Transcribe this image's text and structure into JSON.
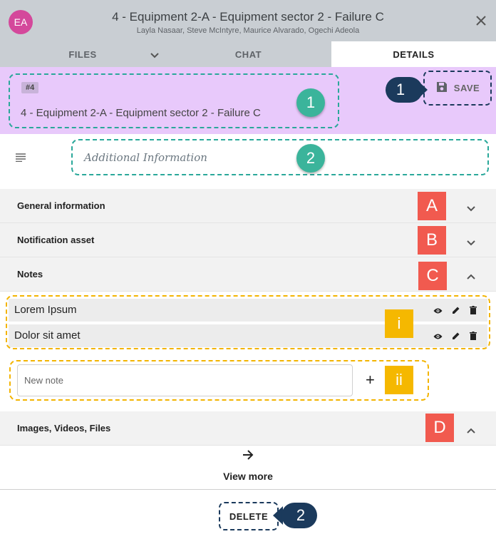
{
  "header": {
    "avatar_initials": "EA",
    "title": "4 - Equipment 2-A - Equipment sector 2 - Failure C",
    "subtitle": "Layla Nasaar, Steve McIntyre, Maurice Alvarado, Ogechi Adeola",
    "close_icon": "close-icon"
  },
  "tabs": [
    {
      "label": "FILES"
    },
    {
      "label": "CHAT"
    },
    {
      "label": "DETAILS",
      "active": true
    }
  ],
  "notification": {
    "number_badge": "#4",
    "title": "4 - Equipment 2-A - Equipment sector 2 - Failure C",
    "save_label": "SAVE",
    "additional_info_placeholder": "Additional Information"
  },
  "sections": [
    {
      "label": "General information",
      "marker": "A",
      "expanded": false
    },
    {
      "label": "Notification asset",
      "marker": "B",
      "expanded": false
    },
    {
      "label": "Notes",
      "marker": "C",
      "expanded": true
    },
    {
      "label": "Images, Videos, Files",
      "marker": "D",
      "expanded": true
    }
  ],
  "notes": [
    {
      "text": "Lorem Ipsum"
    },
    {
      "text": "Dolor sit amet"
    }
  ],
  "new_note_placeholder": "New note",
  "add_symbol": "+",
  "view_more_label": "View more",
  "delete_label": "DELETE",
  "markers": {
    "green_1": "1",
    "green_2": "2",
    "pin_save": "1",
    "pin_delete": "2",
    "notes_list": "i",
    "new_note": "ii"
  },
  "colors": {
    "header_bg": "#c9ced3",
    "purple_bg": "#e8c9fb",
    "avatar": "#d4489b",
    "green_marker": "#3bb49b",
    "red_marker": "#f15a4f",
    "yellow_marker": "#f5b800",
    "navy": "#1b3a5c"
  }
}
